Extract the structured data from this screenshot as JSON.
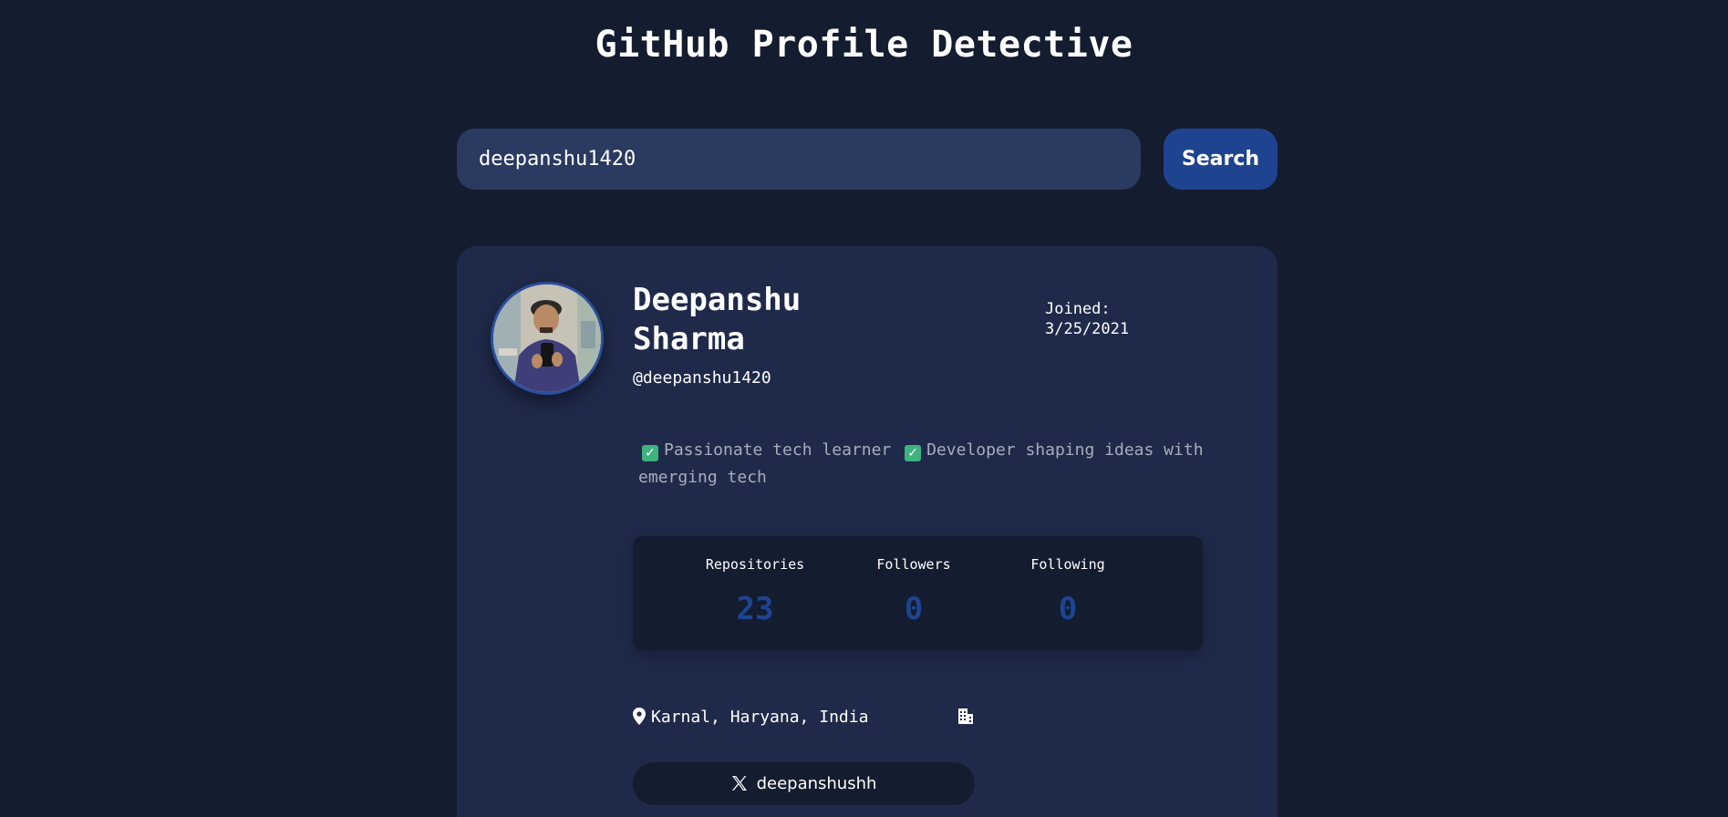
{
  "page": {
    "title": "GitHub Profile Detective"
  },
  "search": {
    "value": "deepanshu1420",
    "button_label": "Search"
  },
  "profile": {
    "name": "Deepanshu Sharma",
    "login": "@deepanshu1420",
    "joined_label": "Joined:",
    "joined_date": "3/25/2021",
    "bio_part1": "Passionate tech learner",
    "bio_part2": "Developer shaping ideas with emerging tech",
    "location": "Karnal, Haryana, India",
    "twitter": "deepanshushh"
  },
  "stats": [
    {
      "label": "Repositories",
      "value": "23"
    },
    {
      "label": "Followers",
      "value": "0"
    },
    {
      "label": "Following",
      "value": "0"
    }
  ],
  "icons": {
    "bio_marker": "check-box-icon",
    "location": "map-pin-icon",
    "company": "building-icon",
    "twitter": "x-logo-icon"
  },
  "colors": {
    "background": "#141c2f",
    "card": "#1f2a4a",
    "input": "#2a3a61",
    "accent": "#1e4490",
    "check": "#3fb27f"
  }
}
